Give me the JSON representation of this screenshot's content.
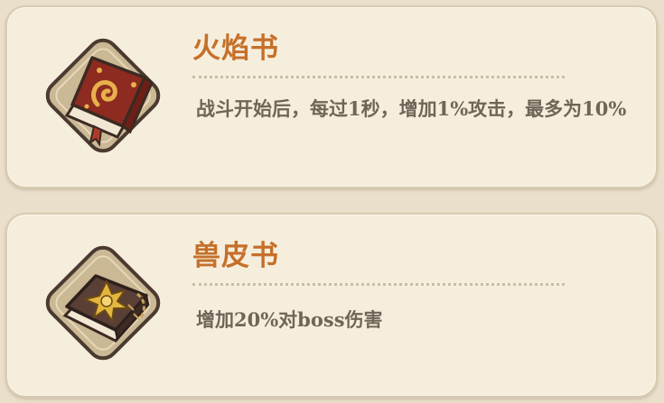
{
  "items": [
    {
      "name": "火焰书",
      "description": "战斗开始后，每过1秒，增加1%攻击，最多为10%",
      "icon": "fire-book-icon"
    },
    {
      "name": "兽皮书",
      "description": "增加20%对boss伤害",
      "icon": "beast-hide-book-icon"
    }
  ],
  "colors": {
    "title": "#c5702a",
    "description": "#6f6558",
    "card_background": "#f6eedd",
    "page_background": "#e9dfcb",
    "icon_frame": "#cbb894",
    "icon_border": "#4a3a30"
  }
}
